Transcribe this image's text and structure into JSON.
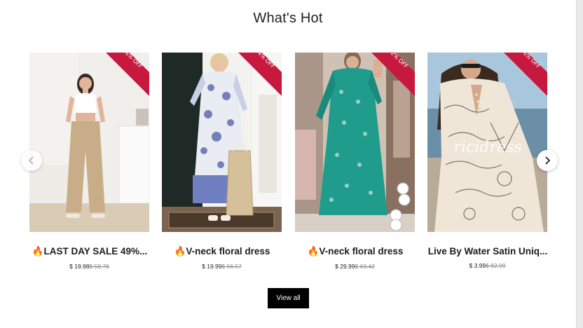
{
  "section": {
    "title": "What's Hot"
  },
  "products": [
    {
      "discount": "66% OFF",
      "title": "🔥LAST DAY SALE 49%...",
      "price": "$ 19.98",
      "old_price": "$ 58.76"
    },
    {
      "discount": "64% OFF",
      "title": "🔥V-neck floral dress",
      "price": "$ 19.99",
      "old_price": "$ 56.57"
    },
    {
      "discount": "52% OFF",
      "title": "🔥V-neck floral dress",
      "price": "$ 29.99",
      "old_price": "$ 63.42"
    },
    {
      "discount": "96% OFF",
      "title": "Live By Water Satin Uniq...",
      "price": "$ 3.99",
      "old_price": "$ 82.99",
      "watermark": "ricidress"
    }
  ],
  "carousel": {
    "prev_icon": "chevron-left-icon",
    "next_icon": "chevron-right-icon"
  },
  "actions": {
    "view_all_label": "View all"
  },
  "colors": {
    "badge": "#c7193d",
    "button": "#000000"
  }
}
